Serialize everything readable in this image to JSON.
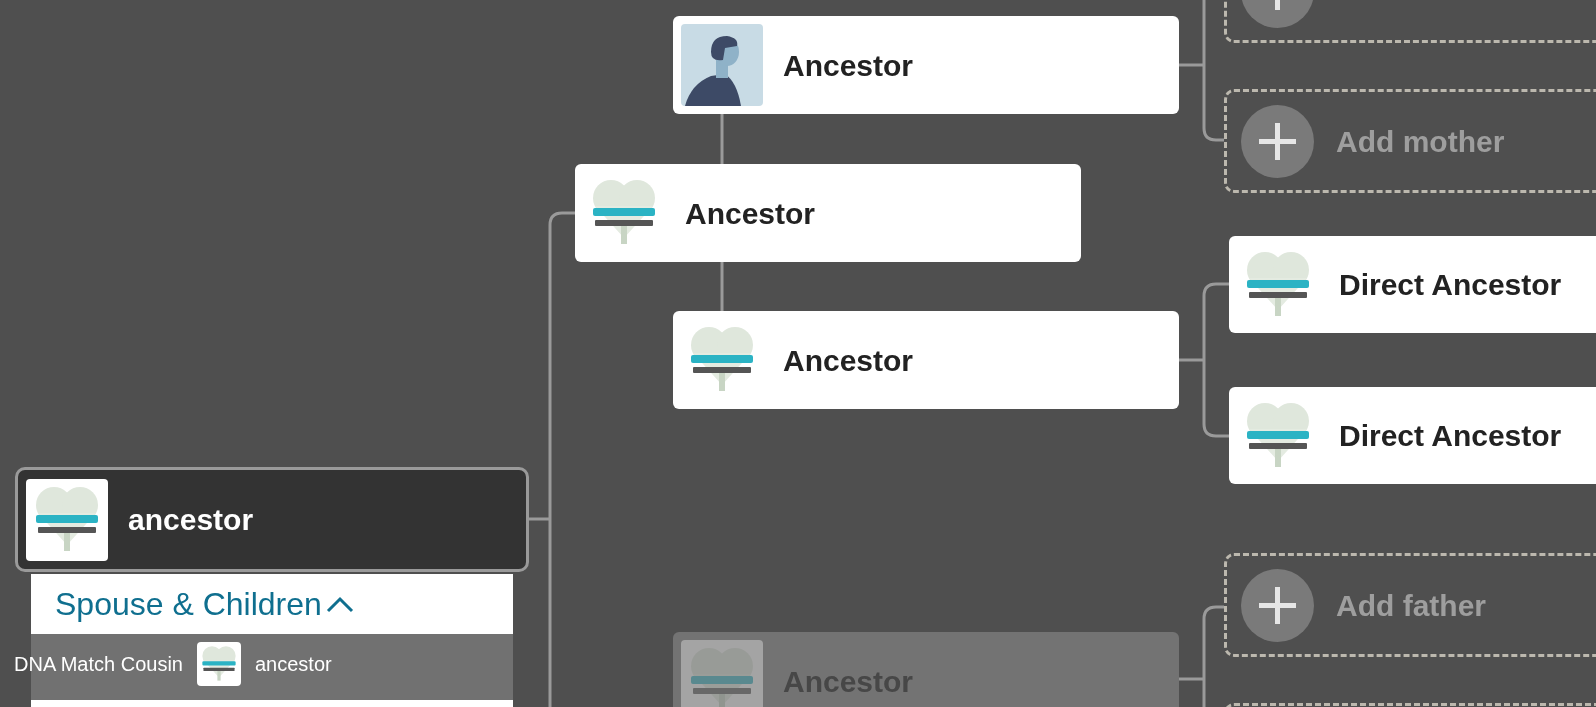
{
  "tree_nodes": [
    {
      "name": "Ancestor",
      "kind": "silhouette",
      "dimmed": false
    },
    {
      "name": "Ancestor",
      "kind": "logo",
      "dimmed": false
    },
    {
      "name": "Ancestor",
      "kind": "logo",
      "dimmed": false
    },
    {
      "name": "Direct Ancestor",
      "kind": "logo",
      "dimmed": false
    },
    {
      "name": "Direct Ancestor",
      "kind": "logo",
      "dimmed": false
    },
    {
      "name": "Ancestor",
      "kind": "logo",
      "dimmed": true
    }
  ],
  "focus_person": {
    "name": "ancestor",
    "selected": true
  },
  "family_panel": {
    "heading": "Spouse & Children",
    "expanded": true,
    "members": [
      {
        "dimmed": true
      }
    ]
  },
  "add_slots": [
    {
      "label": "Add mother"
    },
    {
      "label": "Add father"
    }
  ],
  "drag_label": {
    "title": "DNA Match Cousin",
    "name": "ancestor"
  }
}
